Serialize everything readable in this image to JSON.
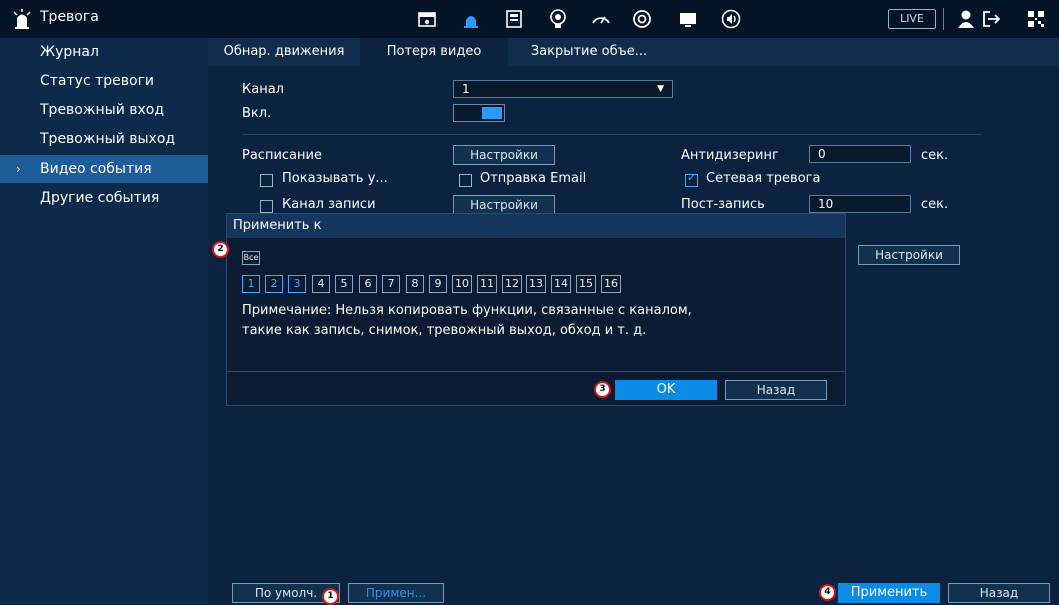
{
  "topbar": {
    "title": "Тревога",
    "icons": [
      "camera-icon",
      "alarm-icon",
      "storage-icon",
      "ai-icon",
      "network-icon",
      "system-icon",
      "monitor-icon",
      "audio-icon"
    ],
    "live": "LIVE",
    "right_icons": [
      "user-icon",
      "logout-icon",
      "qr-icon"
    ]
  },
  "sidebar": {
    "items": [
      {
        "label": "Журнал"
      },
      {
        "label": "Статус тревоги"
      },
      {
        "label": "Тревожный вход"
      },
      {
        "label": "Тревожный выход"
      },
      {
        "label": "Видео события"
      },
      {
        "label": "Другие события"
      }
    ],
    "active_index": 4,
    "arrow": "›"
  },
  "tabs": [
    "Обнар. движения",
    "Потеря видео",
    "Закрытие объе..."
  ],
  "form": {
    "channel_label": "Канал",
    "channel_value": "1",
    "enable_label": "Вкл.",
    "schedule_label": "Расписание",
    "schedule_btn": "Настройки",
    "antidither_label": "Антидизеринг",
    "antidither_value": "0",
    "sec1": "сек.",
    "show_msg_label": "Показывать у...",
    "email_label": "Отправка Email",
    "net_alarm_label": "Сетевая тревога",
    "rec_channel_label": "Канал записи",
    "rec_btn": "Настройки",
    "post_rec_label": "Пост-запись",
    "post_rec_value": "10",
    "sec2": "сек.",
    "extra_btn": "Настройки"
  },
  "dialog": {
    "title": "Применить к",
    "all_label": "Все",
    "channels": [
      "1",
      "2",
      "3",
      "4",
      "5",
      "6",
      "7",
      "8",
      "9",
      "10",
      "11",
      "12",
      "13",
      "14",
      "15",
      "16"
    ],
    "selected": [
      "1",
      "2",
      "3"
    ],
    "note_line1": "Примечание: Нельзя копировать функции, связанные с каналом,",
    "note_line2": "такие как запись, снимок, тревожный выход, обход и т. д.",
    "ok": "OK",
    "back": "Назад"
  },
  "footer": {
    "default_btn": "По умолч.",
    "copy_btn": "Примен...",
    "apply_btn": "Применить",
    "back_btn": "Назад"
  },
  "badges": [
    "1",
    "2",
    "3",
    "4"
  ],
  "colors": {
    "accent": "#0a8be6",
    "active_side": "#1e5d9a",
    "badge_border": "#d01818"
  }
}
